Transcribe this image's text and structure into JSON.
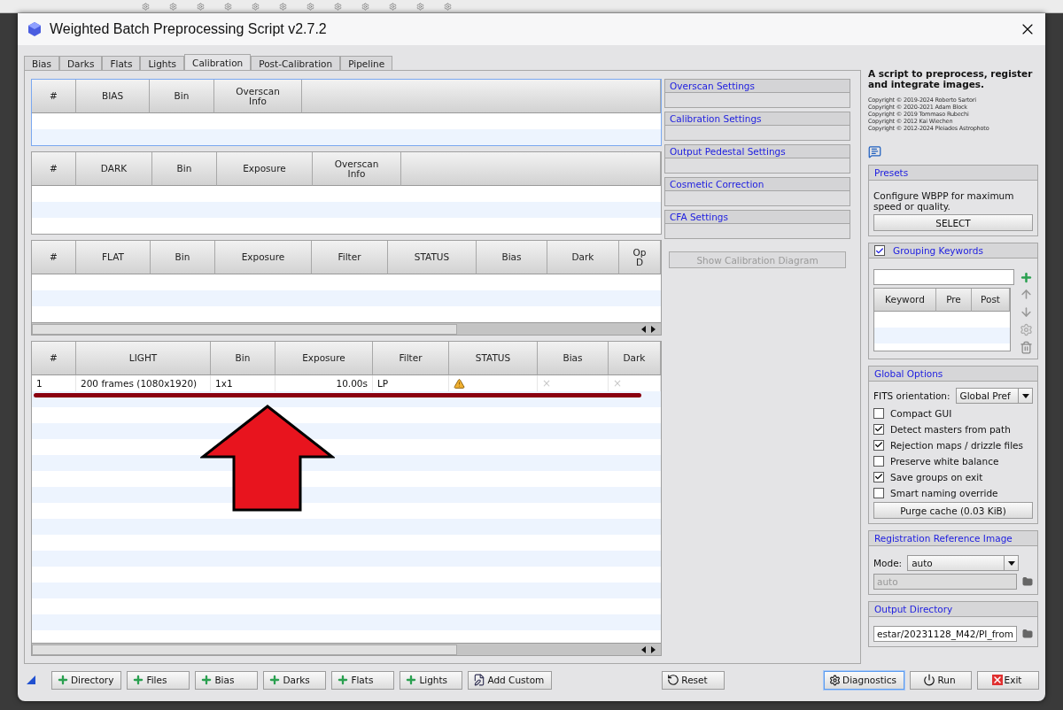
{
  "window": {
    "title": "Weighted Batch Preprocessing Script v2.7.2"
  },
  "tabs": [
    {
      "label": "Bias",
      "selected": false
    },
    {
      "label": "Darks",
      "selected": false
    },
    {
      "label": "Flats",
      "selected": false
    },
    {
      "label": "Lights",
      "selected": false
    },
    {
      "label": "Calibration",
      "selected": true
    },
    {
      "label": "Post-Calibration",
      "selected": false
    },
    {
      "label": "Pipeline",
      "selected": false
    }
  ],
  "tables": [
    {
      "focused": true,
      "hscroll": false,
      "columns": [
        "#",
        "BIAS",
        "Bin",
        "Overscan\nInfo",
        ""
      ]
    },
    {
      "focused": false,
      "hscroll": false,
      "columns": [
        "#",
        "DARK",
        "Bin",
        "Exposure",
        "Overscan\nInfo",
        ""
      ]
    },
    {
      "focused": false,
      "hscroll": true,
      "columns": [
        "#",
        "FLAT",
        "Bin",
        "Exposure",
        "Filter",
        "STATUS",
        "Bias",
        "Dark",
        "Op\nD"
      ]
    },
    {
      "focused": false,
      "hscroll": true,
      "columns": [
        "#",
        "LIGHT",
        "Bin",
        "Exposure",
        "Filter",
        "STATUS",
        "Bias",
        "Dark"
      ],
      "rows": [
        {
          "cells": [
            {
              "kind": "text",
              "text": "1"
            },
            {
              "kind": "text",
              "text": "200 frames (1080x1920)"
            },
            {
              "kind": "text",
              "text": "1x1"
            },
            {
              "kind": "text",
              "text": "10.00s"
            },
            {
              "kind": "text",
              "text": "LP"
            },
            {
              "kind": "warning"
            },
            {
              "kind": "mark",
              "text": "×"
            },
            {
              "kind": "mark",
              "text": "×"
            }
          ]
        }
      ]
    }
  ],
  "side_sections": [
    {
      "title": "Overscan Settings"
    },
    {
      "title": "Calibration Settings"
    },
    {
      "title": "Output Pedestal Settings"
    },
    {
      "title": "Cosmetic Correction"
    },
    {
      "title": "CFA Settings"
    }
  ],
  "diagram_button": {
    "label": "Show Calibration Diagram",
    "disabled": true
  },
  "description": "A script to preprocess, register and integrate images.",
  "copyrights": [
    "Copyright © 2019-2024 Roberto Sartori",
    "Copyright © 2020-2021 Adam Block",
    "Copyright © 2019 Tommaso Rubechi",
    "Copyright © 2012 Kai Wiechen",
    "Copyright © 2012-2024 Pleiades Astrophoto"
  ],
  "presets": {
    "title": "Presets",
    "text": "Configure WBPP for maximum speed or quality.",
    "button": "SELECT"
  },
  "grouping": {
    "title": "Grouping Keywords",
    "checked": true,
    "columns": [
      "Keyword",
      "Pre",
      "Post"
    ]
  },
  "global_options": {
    "title": "Global Options",
    "fits_label": "FITS orientation:",
    "fits_value": "Global Pref",
    "options": [
      {
        "label": "Compact GUI",
        "checked": false
      },
      {
        "label": "Detect masters from path",
        "checked": true
      },
      {
        "label": "Rejection maps / drizzle files",
        "checked": true
      },
      {
        "label": "Preserve white balance",
        "checked": false
      },
      {
        "label": "Save groups on exit",
        "checked": true
      },
      {
        "label": "Smart naming override",
        "checked": false
      }
    ],
    "purge_button": "Purge cache (0.03 KiB)"
  },
  "registration": {
    "title": "Registration Reference Image",
    "mode_label": "Mode:",
    "mode_value": "auto",
    "image_value": "auto"
  },
  "output": {
    "title": "Output Directory",
    "value": "estar/20231128_M42/PI_from"
  },
  "add_buttons": [
    {
      "label": "Directory",
      "kind": "plus"
    },
    {
      "label": "Files",
      "kind": "plus"
    },
    {
      "label": "Bias",
      "kind": "plus"
    },
    {
      "label": "Darks",
      "kind": "plus"
    },
    {
      "label": "Flats",
      "kind": "plus"
    },
    {
      "label": "Lights",
      "kind": "plus"
    },
    {
      "label": "Add Custom",
      "kind": "edit"
    }
  ],
  "reset_button": "Reset",
  "actions": [
    {
      "label": "Diagnostics",
      "kind": "diagnostics",
      "focused": true
    },
    {
      "label": "Run",
      "kind": "run",
      "focused": false
    },
    {
      "label": "Exit",
      "kind": "exit",
      "focused": false
    }
  ]
}
